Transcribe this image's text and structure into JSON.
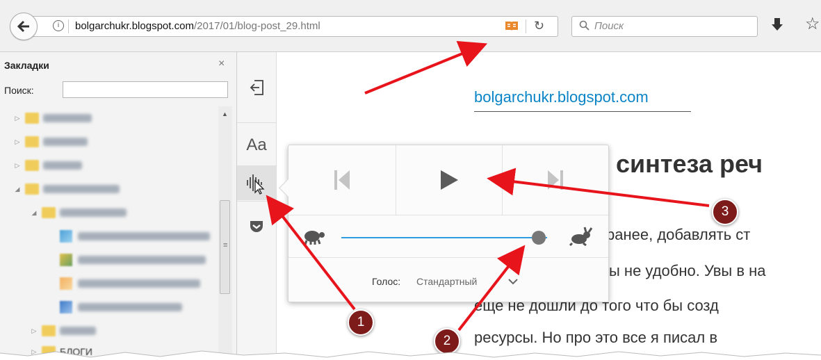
{
  "toolbar": {
    "url_host": "bolgarchukr.blogspot.com",
    "url_path": "/2017/01/blog-post_29.html",
    "search_placeholder": "Поиск"
  },
  "sidebar": {
    "title": "Закладки",
    "close_glyph": "×",
    "search_label": "Поиск:",
    "tree": [
      {
        "type": "folder",
        "twisty": "▷"
      },
      {
        "type": "folder",
        "twisty": "▷"
      },
      {
        "type": "folder",
        "twisty": "▷"
      },
      {
        "type": "folder",
        "twisty": "◢"
      },
      {
        "type": "folder",
        "twisty": "◢"
      },
      {
        "type": "page"
      },
      {
        "type": "page"
      },
      {
        "type": "page"
      },
      {
        "type": "page"
      },
      {
        "type": "folder",
        "twisty": "▷"
      },
      {
        "type": "folder",
        "twisty": "▷"
      }
    ],
    "last_visible_label": "БЛОГИ"
  },
  "reader": {
    "font_button_label": "Aa"
  },
  "article": {
    "domain": "bolgarchukr.blogspot.com",
    "heading_fragment": "синтеза реч",
    "lines": [
      "ранее, добавлять ст",
      "ы не удобно. Увы в на",
      "еще не дошли до того что бы созд",
      "ресурсы. Но про это все я писал в"
    ]
  },
  "narrate": {
    "voice_label": "Голос:",
    "voice_value": "Стандартный",
    "rate_fraction": 1.0
  },
  "annotations": {
    "badges": [
      "1",
      "2",
      "3"
    ],
    "color": "#7d1a1a",
    "arrow_color": "#e8141c"
  },
  "colors": {
    "link": "#0a84c6",
    "slider": "#2e9be0",
    "reader_icon": "#e8882a"
  }
}
